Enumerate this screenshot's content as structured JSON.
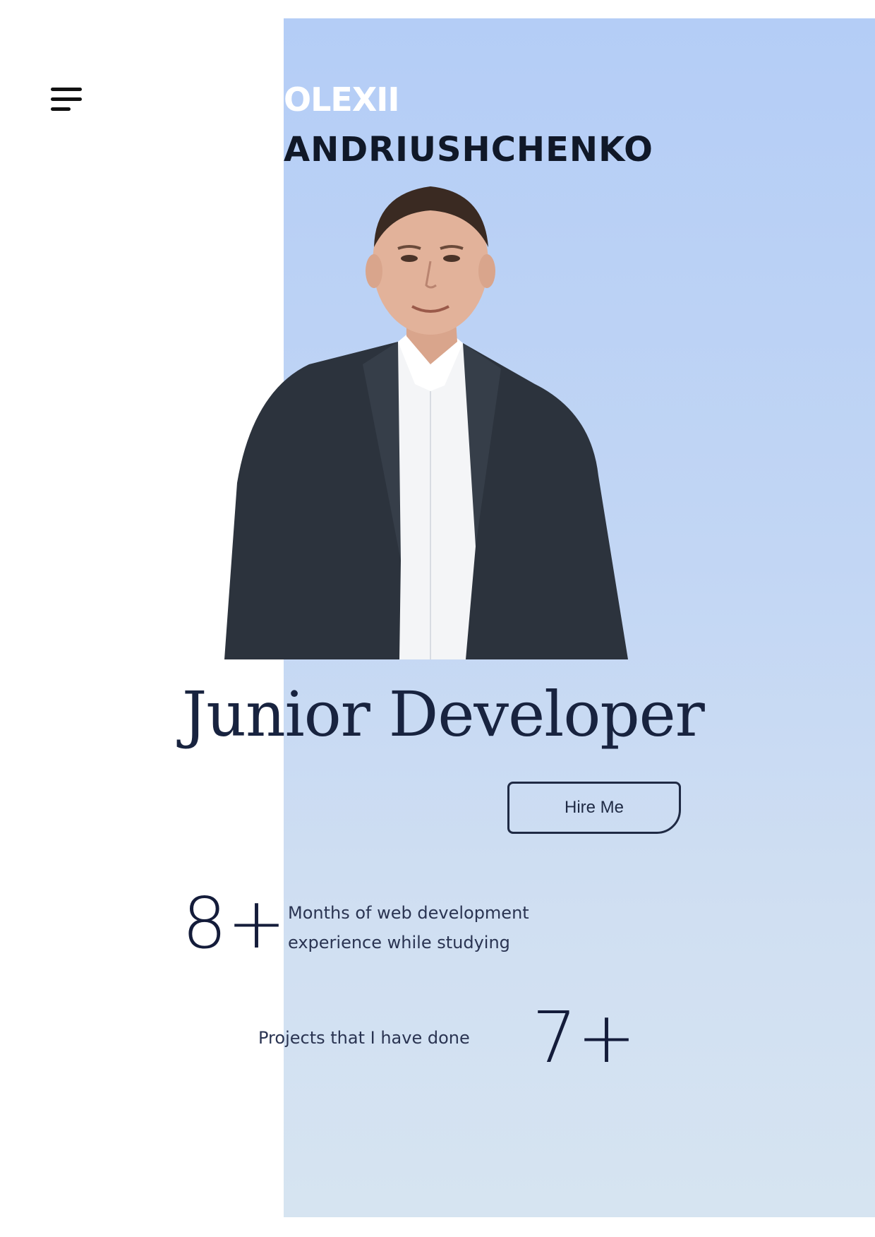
{
  "header": {
    "first_name": "OLEXII",
    "last_name": "ANDRIUSHCHENKO",
    "menu_icon": "hamburger-menu-icon"
  },
  "hero": {
    "photo": "portrait-photo",
    "title": "Junior Developer",
    "cta_label": "Hire Me"
  },
  "stats": [
    {
      "value": "8+",
      "label": "Months of web development experience while studying"
    },
    {
      "value": "7+",
      "label": "Projects that I have done"
    }
  ],
  "colors": {
    "panel_top": "#b4cdf6",
    "panel_bottom": "#d6e4f1",
    "text_dark": "#18233f",
    "name_white": "#ffffff"
  }
}
